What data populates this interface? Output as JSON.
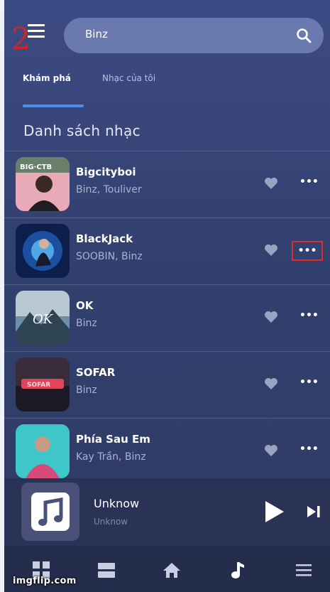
{
  "header": {
    "step_number": "2",
    "search_value": "Binz"
  },
  "tabs": [
    {
      "label": "Khám phá",
      "active": true
    },
    {
      "label": "Nhạc của tôi",
      "active": false
    }
  ],
  "section_title": "Danh sách nhạc",
  "songs": [
    {
      "title": "Bigcityboi",
      "artist": "Binz, Touliver",
      "cover": "pink-street-photo"
    },
    {
      "title": "BlackJack",
      "artist": "SOOBIN, Binz",
      "cover": "blue-portrait",
      "more_highlighted": true
    },
    {
      "title": "OK",
      "artist": "Binz",
      "cover": "mountain-landscape"
    },
    {
      "title": "SOFAR",
      "artist": "Binz",
      "cover": "neon-sign"
    },
    {
      "title": "Phía Sau Em",
      "artist": "Kay Trần, Binz",
      "cover": "teal-portrait"
    }
  ],
  "player": {
    "title": "Unknow",
    "artist": "Unknow"
  },
  "bottom_nav": [
    {
      "icon": "grid-icon"
    },
    {
      "icon": "list-icon"
    },
    {
      "icon": "home-icon"
    },
    {
      "icon": "music-note-icon",
      "active": true
    },
    {
      "icon": "menu-icon"
    }
  ],
  "watermark": "imgflip.com",
  "colors": {
    "background": "#334170",
    "accent": "#4a90e8",
    "highlight": "#e02b2b",
    "player": "#2a3356",
    "nav": "#252d4d"
  }
}
